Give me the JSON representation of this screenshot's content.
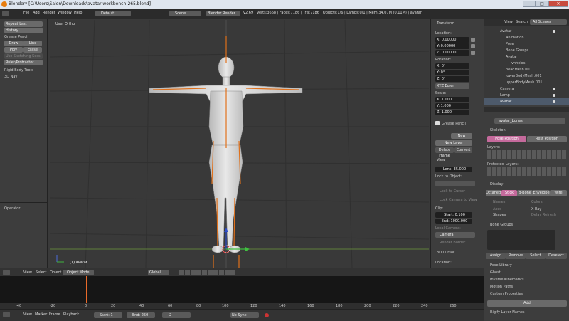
{
  "window": {
    "title": "Blender* [C:\\Users\\Salon\\Downloads\\avatar-workbench-265.blend]",
    "minimize": "–",
    "maximize": "□",
    "close": "✕"
  },
  "menubar": {
    "items": [
      "File",
      "Add",
      "Render",
      "Window",
      "Help"
    ],
    "layout": "Default",
    "scene": "Scene",
    "engine": "Blender Render",
    "stats": "v2.69 | Verts:3668 | Faces:7186 | Tris:7186 | Objects:1/6 | Lamps:0/1 | Mem:34.07M (0.11M) | avatar"
  },
  "toolshelf": {
    "buttons": [
      "Repeat Last",
      "History..."
    ],
    "grease_pencil": {
      "label": "Grease Pencil",
      "draw": "Draw",
      "line": "Line",
      "poly": "Poly",
      "erase": "Erase",
      "stroke": "Use Sketching Sess",
      "ruler": "Ruler/Protractor"
    },
    "rigid_body": "Rigid Body Tools",
    "nav": "3D Nav",
    "operator": "Operator"
  },
  "viewport": {
    "view_label": "User Ortho",
    "object_label": "(1) avatar"
  },
  "npanel": {
    "transform": "Transform",
    "location": "Location:",
    "loc": [
      "X: 0.00000",
      "Y: 0.00000",
      "Z: 0.00000"
    ],
    "rotation": "Rotation:",
    "rot": [
      "X: 0°",
      "Y: 0°",
      "Z: 0°"
    ],
    "euler": "XYZ Euler",
    "scale": "Scale:",
    "scl": [
      "X: 1.000",
      "Y: 1.000",
      "Z: 1.000"
    ],
    "grease": "Grease Pencil",
    "gp_new": "New",
    "gp_newlayer": "New Layer",
    "gp_delete": "Delete Frame",
    "gp_convert": "Convert",
    "view": "View",
    "lens": "Lens: 35.000",
    "lock_object": "Lock to Object:",
    "lock_cursor": "Lock to Cursor",
    "lock_camera": "Lock Camera to View",
    "clip": "Clip:",
    "clip_start": "Start: 0.100",
    "clip_end": "End: 1000.000",
    "local_camera": "Local Camera:",
    "camera": "Camera",
    "render_border": "Render Border",
    "cursor": "3D Cursor",
    "cursor_location": "Location:"
  },
  "outliner": {
    "view": "View",
    "search": "Search",
    "scenes": "All Scenes",
    "items": [
      "Avatar",
      "Animation",
      "Pose",
      "Bone Groups",
      "Avatar",
      "vhhelos",
      "headMesh.001",
      "lowerBodyMesh.001",
      "upperBodyMesh.001",
      "Camera",
      "Lamp",
      "avatar"
    ]
  },
  "properties": {
    "data_name": "avatar_bones",
    "skeleton": "Skeleton",
    "pose_position": "Pose Position",
    "rest_position": "Rest Position",
    "layers": "Layers:",
    "protected_layers": "Protected Layers:",
    "display": "Display",
    "display_types": [
      "Octahedral",
      "Stick",
      "B-Bone",
      "Envelope",
      "Wire"
    ],
    "names": "Names",
    "colors": "Colors",
    "axes": "Axes",
    "xray": "X-Ray",
    "shapes": "Shapes",
    "delay_refresh": "Delay Refresh",
    "bone_groups": "Bone Groups",
    "bg_buttons": [
      "Assign",
      "Remove",
      "Select",
      "Deselect"
    ],
    "sections": [
      "Pose Library",
      "Ghost",
      "Inverse Kinematics",
      "Motion Paths",
      "Custom Properties"
    ],
    "add": "Add",
    "rigify": "Rigify Layer Names"
  },
  "vpheader": {
    "items": [
      "View",
      "Select",
      "Object"
    ],
    "mode": "Object Mode",
    "orientation": "Global"
  },
  "timeline": {
    "ticks": [
      "-40",
      "-20",
      "0",
      "20",
      "40",
      "60",
      "80",
      "100",
      "120",
      "140",
      "160",
      "180",
      "200",
      "220",
      "240",
      "260"
    ],
    "items": [
      "View",
      "Marker",
      "Frame",
      "Playback"
    ],
    "start": "Start: 1",
    "end": "End: 250",
    "current": "2",
    "sync": "No Sync",
    "current_frame": 2
  }
}
